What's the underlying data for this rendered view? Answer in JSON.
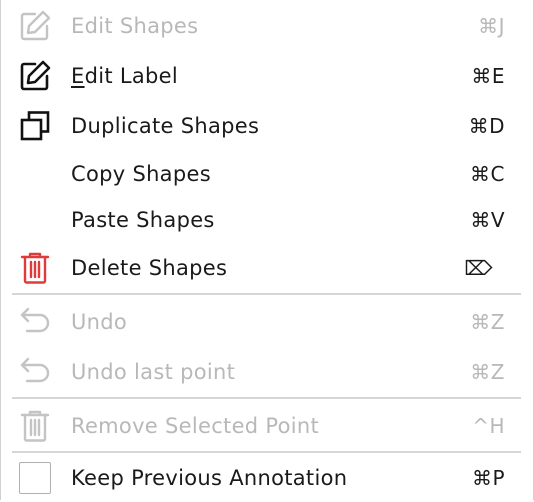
{
  "menu": {
    "items": [
      {
        "label": "Edit Shapes",
        "shortcut": "⌘J",
        "icon": "edit-shapes-icon",
        "enabled": false
      },
      {
        "label_first": "E",
        "label_rest": "dit Label",
        "shortcut": "⌘E",
        "icon": "edit-label-icon",
        "enabled": true
      },
      {
        "label": "Duplicate Shapes",
        "shortcut": "⌘D",
        "icon": "duplicate-icon",
        "enabled": true
      },
      {
        "label": "Copy Shapes",
        "shortcut": "⌘C",
        "enabled": true
      },
      {
        "label": "Paste Shapes",
        "shortcut": "⌘V",
        "enabled": true
      },
      {
        "label": "Delete Shapes",
        "shortcut": "⌦",
        "icon": "trash-icon",
        "enabled": true
      },
      {
        "label": "Undo",
        "shortcut": "⌘Z",
        "icon": "undo-icon",
        "enabled": false
      },
      {
        "label": "Undo last point",
        "shortcut": "⌘Z",
        "icon": "undo-icon",
        "enabled": false
      },
      {
        "label": "Remove Selected Point",
        "shortcut": "^H",
        "icon": "trash-icon",
        "enabled": false
      },
      {
        "label": "Keep Previous Annotation",
        "shortcut": "⌘P",
        "icon": "checkbox-icon",
        "enabled": true,
        "checked": false
      }
    ]
  },
  "colors": {
    "text": "#1a1a1a",
    "disabled": "#b8b8b8",
    "delete_icon": "#e03b3b",
    "separator": "#d6d6d6"
  }
}
